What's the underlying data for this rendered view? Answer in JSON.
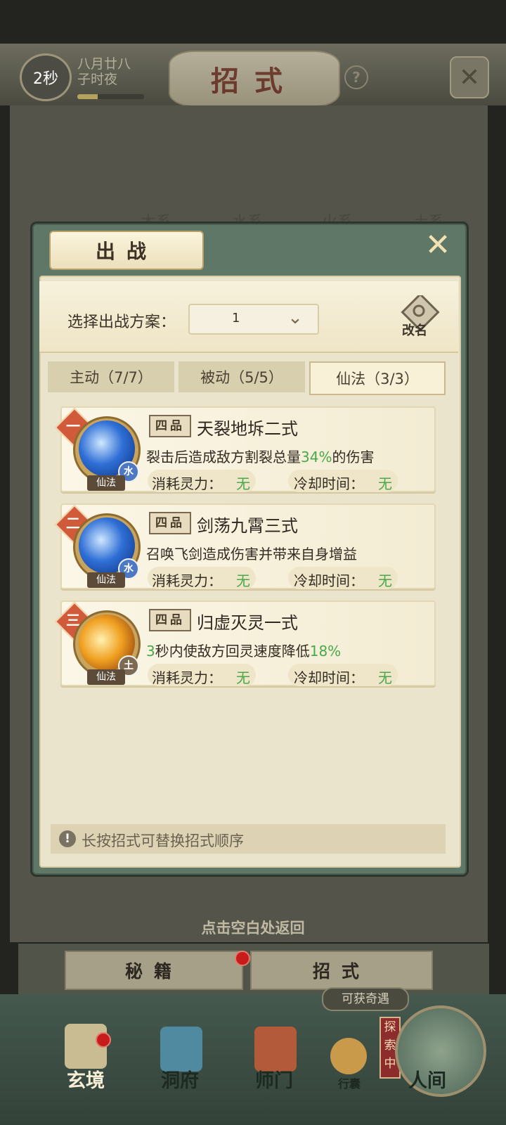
{
  "header": {
    "timer": "2秒",
    "date_line1": "八月廿八",
    "date_line2": "子时夜",
    "title": "招式",
    "help_glyph": "?",
    "day_progress": 0.3
  },
  "background_tabs": [
    "木系",
    "水系",
    "火系",
    "土系"
  ],
  "panel": {
    "title": "出战",
    "scheme": {
      "label": "选择出战方案：",
      "value": "1",
      "rename_label": "改名"
    },
    "tabs": [
      {
        "label": "主动（7/7）",
        "active": false
      },
      {
        "label": "被动（5/5）",
        "active": false
      },
      {
        "label": "仙法（3/3）",
        "active": true
      }
    ],
    "skills": [
      {
        "index": "一",
        "grade": "四品",
        "name": "天裂地坼二式",
        "desc_pre": "裂击后造成敌方割裂总量",
        "desc_hl": "34%",
        "desc_post": "的伤害",
        "element": "水",
        "type_tag": "仙法",
        "cost_label": "消耗灵力：",
        "cost_value": "无",
        "cd_label": "冷却时间：",
        "cd_value": "无"
      },
      {
        "index": "二",
        "grade": "四品",
        "name": "剑荡九霄三式",
        "desc_pre": "召唤飞剑造成伤害并带来自身增益",
        "desc_hl": "",
        "desc_post": "",
        "element": "水",
        "type_tag": "仙法",
        "cost_label": "消耗灵力：",
        "cost_value": "无",
        "cd_label": "冷却时间：",
        "cd_value": "无"
      },
      {
        "index": "三",
        "grade": "四品",
        "name": "归虚灭灵一式",
        "desc_hl0": "3",
        "desc_pre": "秒内使敌方回灵速度降低",
        "desc_hl": "18%",
        "desc_post": "",
        "element": "土",
        "type_tag": "仙法",
        "cost_label": "消耗灵力：",
        "cost_value": "无",
        "cd_label": "冷却时间：",
        "cd_value": "无"
      }
    ],
    "tip_glyph": "!",
    "tip": "长按招式可替换招式顺序"
  },
  "back_hint": "点击空白处返回",
  "subtabs": [
    "秘籍",
    "招式"
  ],
  "encounter_label": "可获奇遇",
  "explore_label": "探索中",
  "nav": {
    "items": [
      "玄境",
      "洞府",
      "师门",
      "行囊",
      "人间"
    ],
    "active": "玄境"
  },
  "colors": {
    "panel_green": "#5f7767",
    "accent_red": "#d15a3a",
    "value_green": "#4aa84a",
    "title_red": "#7a2a1d"
  }
}
